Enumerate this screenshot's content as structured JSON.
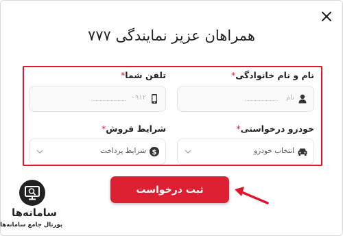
{
  "modal": {
    "title": "همراهان عزیز نمایندگی ۷۷۷"
  },
  "form": {
    "name_field": {
      "label": "نام و نام خانوادگی",
      "required_mark": "*",
      "placeholder": "نام",
      "icon": "user-icon"
    },
    "phone_field": {
      "label": "تلفن شما",
      "required_mark": "*",
      "placeholder": "۰۹۱۲",
      "icon": "mobile-phone-icon"
    },
    "car_field": {
      "label": "خودرو درخواستی",
      "required_mark": "*",
      "selected": "انتخاب خودرو",
      "icon": "car-icon"
    },
    "sale_terms_field": {
      "label": "شرایط فروش",
      "required_mark": "*",
      "selected": "شرایط پرداخت",
      "icon": "dollar-coin-icon"
    },
    "submit_label": "ثبت درخواست"
  },
  "watermark": {
    "name": "سامانه‌ها",
    "subtitle": "پورتال جامع سامانه‌ها"
  },
  "colors": {
    "accent": "#dd1f32",
    "highlight_border": "#e0142b"
  }
}
